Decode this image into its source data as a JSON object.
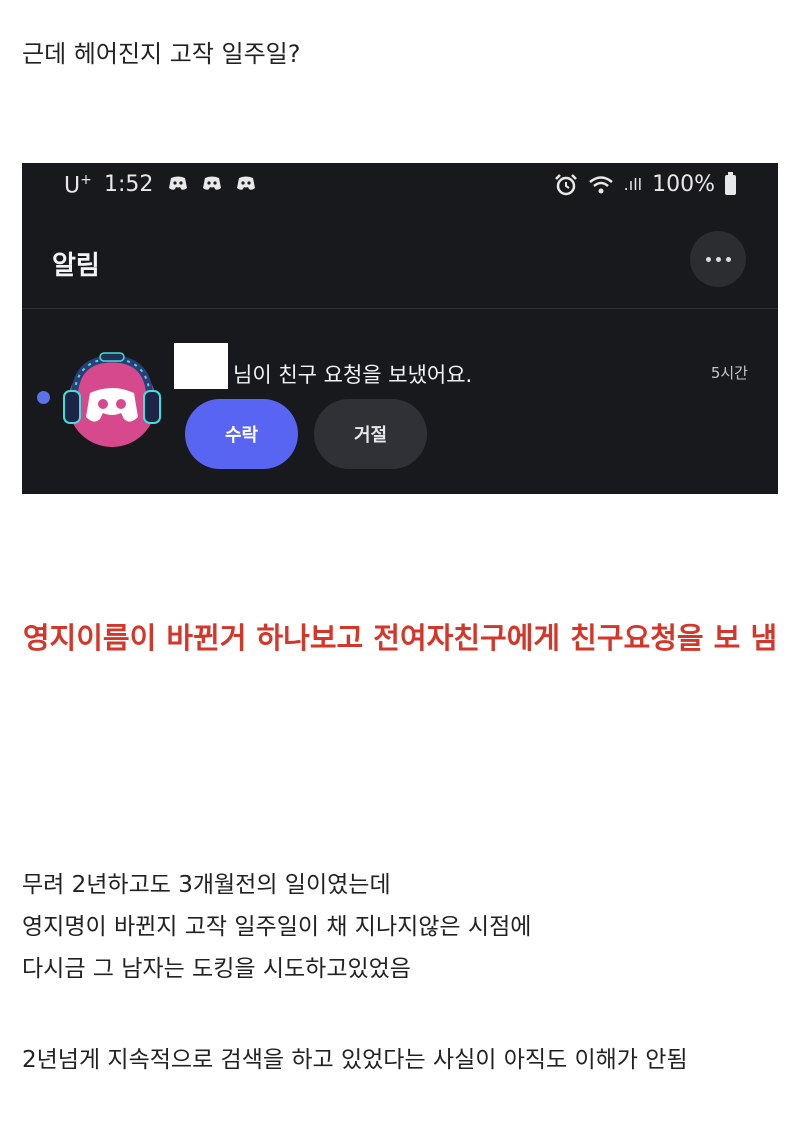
{
  "post": {
    "intro": "근데 헤어진지 고작 일주일?",
    "headline": "영지이름이 바뀐거 하나보고 전여자친구에게 친구요청을 보 냄",
    "paragraph_lines": [
      "무려 2년하고도 3개월전의 일이였는데",
      "영지명이 바뀐지 고작 일주일이 채 지나지않은 시점에",
      "다시금 그 남자는 도킹을 시도하고있었음"
    ],
    "closing": "2년넘게 지속적으로 검색을 하고 있었다는 사실이 아직도 이해가 안됨"
  },
  "screenshot": {
    "status_bar": {
      "carrier": "U",
      "carrier_sup": "+",
      "time": "1:52",
      "signal_text": ".ıll",
      "battery": "100%"
    },
    "header": {
      "title": "알림"
    },
    "notification": {
      "message": "님이 친구 요청을 보냈어요.",
      "time_ago": "5시간",
      "accept_label": "수락",
      "decline_label": "거절"
    }
  },
  "colors": {
    "headline_red": "#d4362a",
    "discord_blurple": "#5865f2",
    "avatar_pink": "#d6498c",
    "dark_bg": "#18191c"
  }
}
